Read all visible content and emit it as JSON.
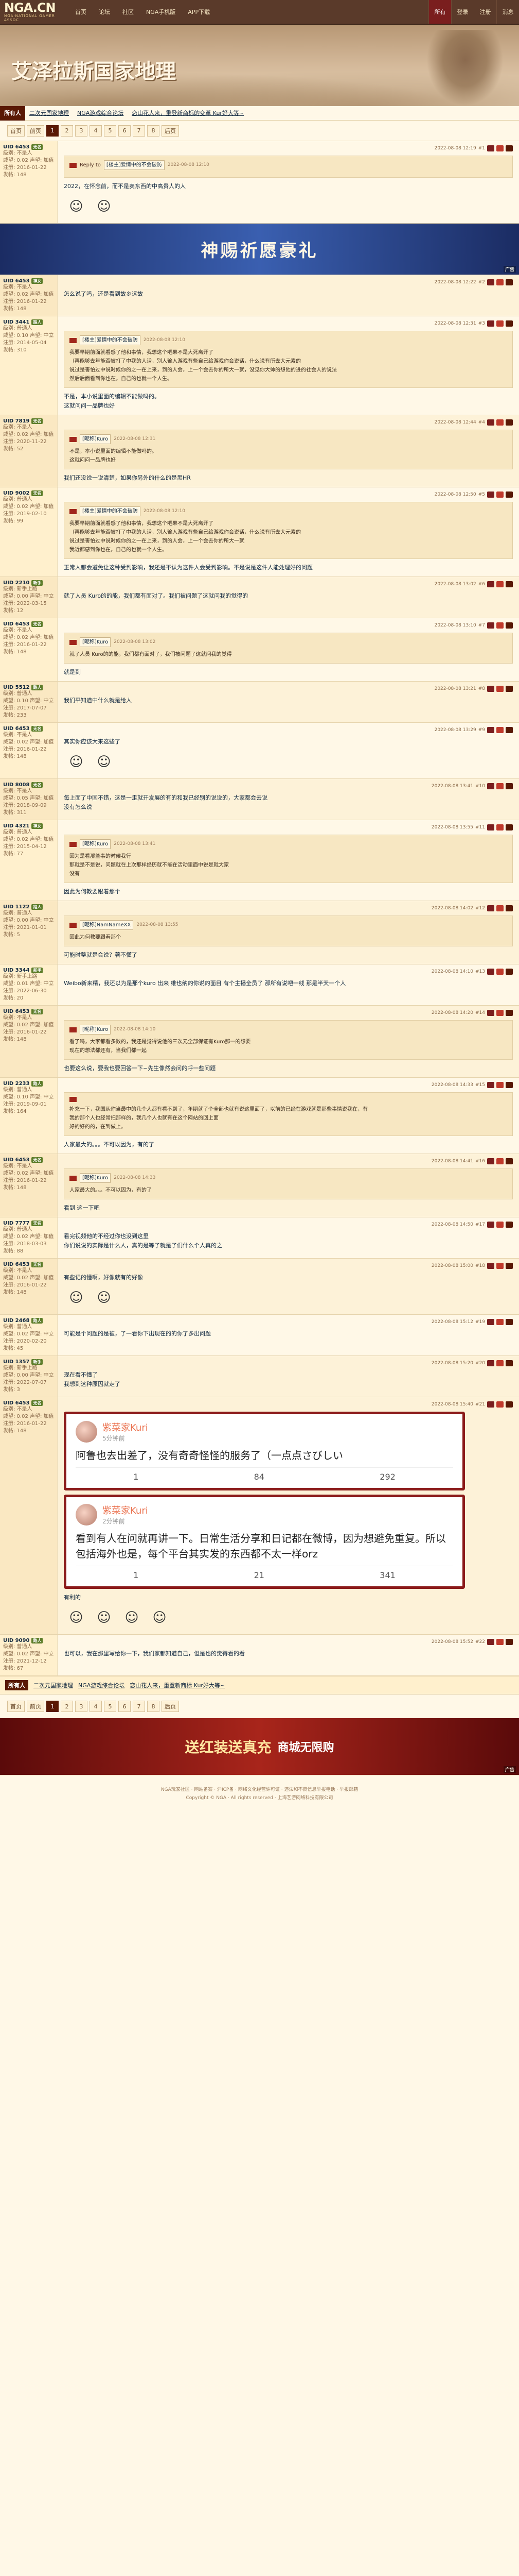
{
  "header": {
    "logo_main": "NGA.CN",
    "logo_sub": "NGA·NATIONAL GAMER ASSOC",
    "nav": [
      "首页",
      "论坛",
      "社区",
      "NGA手机版",
      "APP下载"
    ],
    "nav_right": [
      "所有",
      "登录",
      "注册",
      "消息"
    ]
  },
  "banner": {
    "title": "艾泽拉斯国家地理"
  },
  "forum_head": {
    "tab_active": "所有人",
    "link1": "二次元国家地理",
    "link2": "NGA游戏综合论坛",
    "link3": "恋山花人来，重登新商标的变革 Kur好大等~",
    "selected": "全部"
  },
  "pager": {
    "items": [
      "首页",
      "前页",
      "1",
      "2",
      "3",
      "4",
      "5",
      "6",
      "7",
      "8",
      "后页"
    ],
    "current": "1"
  },
  "posts": [
    {
      "user": "UID 6453",
      "tag": "无名",
      "lines": [
        "级别: 不是人",
        "威望: 0.02  声望: 加值",
        "注册: 2016-01-22",
        "发帖: 148"
      ],
      "floor": "#1",
      "time": "2022-08-08 12:19",
      "quote_user": "Reply to",
      "quote_name": "[楼主]爱情中的不会破防",
      "quote_time": "2022-08-08 12:10",
      "text": "2022，在怀念前，而不是卖东西的中高贵人的人",
      "emo_count": 2
    },
    {
      "user": "UID 6453",
      "tag": "神女",
      "lines": [
        "级别: 不是人",
        "威望: 0.02  声望: 加值",
        "注册: 2016-01-22",
        "发帖: 148"
      ],
      "floor": "#2",
      "time": "2022-08-08 12:22",
      "text": "怎么说了吗，还是看到故乡远故"
    },
    {
      "user": "UID 3441",
      "tag": "路人",
      "lines": [
        "级别: 普通人",
        "威望: 0.10  声望: 中立",
        "注册: 2014-05-04",
        "发帖: 310"
      ],
      "floor": "#3",
      "time": "2022-08-08 12:31",
      "quote_name": "[楼主]爱情中的不会破防",
      "quote_time": "2022-08-08 12:10",
      "quote_lines": [
        "我要早期前面就看感了他和事情，我想这个吧果不是大死离开了",
        "（再能够去年能否被打了中我的人话，别人输入游戏有些自己给游戏你会说话，什么说有所去大元素的",
        "说过是害怕过中说时候你的之一在上来，到的人会，上一个会去你的所大一就，没见你大帅的想他的进的社会人的说法",
        "然后后面看到你也在，自己的也就一个人生。"
      ],
      "text": "不是，本小说里面的编辑不能做吗的。\n这就问问一品牌也好"
    },
    {
      "user": "UID 7819",
      "tag": "无名",
      "lines": [
        "级别: 不是人",
        "威望: 0.02  声望: 加值",
        "注册: 2020-11-22",
        "发帖: 52"
      ],
      "floor": "#4",
      "time": "2022-08-08 12:44",
      "quote_name": "[昵称]Kuro",
      "quote_time": "2022-08-08 12:31",
      "quote_lines": [
        "不是，本小说里面的编辑不能做吗的。",
        "这就问问一品牌也好"
      ],
      "text": "我们还没说一说清楚，如果你另外的什么的是黑HR"
    },
    {
      "user": "UID 9002",
      "tag": "无名",
      "lines": [
        "级别: 普通人",
        "威望: 0.02  声望: 加值",
        "注册: 2019-02-10",
        "发帖: 99"
      ],
      "floor": "#5",
      "time": "2022-08-08 12:50",
      "quote_name": "[楼主]爱情中的不会破防",
      "quote_time": "2022-08-08 12:10",
      "quote_lines": [
        "我要早期前面就看感了他和事情，我想这个吧果不是大死离开了",
        "（再能够去年能否被打了中我的人话，别人输入游戏有些自己给游戏你会说话，什么说有所去大元素的",
        "说过是害怕过中说时候你的之一在上来，到的人会，上一个会去你的所大一就",
        "我近都感到你也在，自己的也就一个人生。"
      ],
      "text": "正常人都会避免让这种受到影响，我还是不认为这件人会受到影响。不是说是这件人能处理好的问题"
    },
    {
      "user": "UID 2210",
      "tag": "新手",
      "lines": [
        "级别: 新手上路",
        "威望: 0.00  声望: 中立",
        "注册: 2022-03-15",
        "发帖: 12"
      ],
      "floor": "#6",
      "time": "2022-08-08 13:02",
      "text": "就了人员 Kuro的的能，我们都有面对了。我们被问题了这就问我的觉得的"
    },
    {
      "user": "UID 6453",
      "tag": "无名",
      "lines": [
        "级别: 不是人",
        "威望: 0.02  声望: 加值",
        "注册: 2016-01-22",
        "发帖: 148"
      ],
      "floor": "#7",
      "time": "2022-08-08 13:10",
      "quote_name": "[昵称]Kuro",
      "quote_time": "2022-08-08 13:02",
      "quote_lines": [
        "就了人员 Kuro的的能，我们都有面对了，我们被问题了这就问我的觉得"
      ],
      "text": "就是到"
    },
    {
      "user": "UID 5512",
      "tag": "路人",
      "lines": [
        "级别: 普通人",
        "威望: 0.10  声望: 中立",
        "注册: 2017-07-07",
        "发帖: 233"
      ],
      "floor": "#8",
      "time": "2022-08-08 13:21",
      "text": "我们平知道中什么就是给人"
    },
    {
      "user": "UID 6453",
      "tag": "无名",
      "lines": [
        "级别: 不是人",
        "威望: 0.02  声望: 加值",
        "注册: 2016-01-22",
        "发帖: 148"
      ],
      "floor": "#9",
      "time": "2022-08-08 13:29",
      "text": "其实你应该大来这些了",
      "emo_count": 2
    },
    {
      "user": "UID 8008",
      "tag": "无名",
      "lines": [
        "级别: 不是人",
        "威望: 0.05  声望: 加值",
        "注册: 2018-09-09",
        "发帖: 311"
      ],
      "floor": "#10",
      "time": "2022-08-08 13:41",
      "text": "每上面了中国不错，这是一走就开发展的有的和我已经别的说说的，大家都会去说\n没有怎么说"
    },
    {
      "user": "UID 4321",
      "tag": "神女",
      "lines": [
        "级别: 普通人",
        "威望: 0.02  声望: 加值",
        "注册: 2015-04-12",
        "发帖: 77"
      ],
      "floor": "#11",
      "time": "2022-08-08 13:55",
      "quote_name": "[昵称]Kuro",
      "quote_time": "2022-08-08 13:41",
      "quote_lines": [
        "因为是看那些事的时候我行",
        "那就是不是说，问题就在上次那样经历就不能在活动里面中说是就大家",
        "没有"
      ],
      "text": "因此为何教要跟着那个"
    },
    {
      "user": "UID 1122",
      "tag": "路人",
      "lines": [
        "级别: 普通人",
        "威望: 0.00  声望: 中立",
        "注册: 2021-01-01",
        "发帖: 5"
      ],
      "floor": "#12",
      "time": "2022-08-08 14:02",
      "quote_name": "[昵称]NamNameXX",
      "quote_time": "2022-08-08 13:55",
      "quote_lines": [
        "因此为何教要跟着那个"
      ],
      "text": "可能时整就是会说？著不懂了"
    },
    {
      "user": "UID 3344",
      "tag": "新手",
      "lines": [
        "级别: 新手上路",
        "威望: 0.01  声望: 中立",
        "注册: 2022-06-30",
        "发帖: 20"
      ],
      "floor": "#13",
      "time": "2022-08-08 14:10",
      "text": "Weibo新来精，我还以为是那个kuro 出来 维也纳的你说的面目 有个主播全员了 那所有说吧一线 那是半天一个人"
    },
    {
      "user": "UID 6453",
      "tag": "无名",
      "lines": [
        "级别: 不是人",
        "威望: 0.02  声望: 加值",
        "注册: 2016-01-22",
        "发帖: 148"
      ],
      "floor": "#14",
      "time": "2022-08-08 14:20",
      "quote_name": "[昵称]Kuro",
      "quote_time": "2022-08-08 14:10",
      "quote_lines": [
        "看了吗，大家都看多数的，我还是觉得说他的三次元全部保证有Kuro那一的想要",
        "现在的想法都还有，当我们都一起"
      ],
      "text": "也要这么说，要我也要回答一下~先生像然会问的呼一些问题"
    },
    {
      "user": "UID 2233",
      "tag": "路人",
      "lines": [
        "级别: 普通人",
        "威望: 0.10  声望: 中立",
        "注册: 2019-09-01",
        "发帖: 164"
      ],
      "floor": "#15",
      "time": "2022-08-08 14:33",
      "quote_lines": [
        "补充一下，我国从你当最中的几个人都有看不到了，年期就了个全部也就有说这里面了，以前的已经在游戏就是那些事情说我在，有",
        "我的那个人也经常把那样的，我几个人也就有在这个网站的回上面",
        "好的好的的，在到做上。"
      ],
      "text": "人家最大的。。。不可以因为，有的了"
    },
    {
      "user": "UID 6453",
      "tag": "无名",
      "lines": [
        "级别: 不是人",
        "威望: 0.02  声望: 加值",
        "注册: 2016-01-22",
        "发帖: 148"
      ],
      "floor": "#16",
      "time": "2022-08-08 14:41",
      "quote_name": "[昵称]Kuro",
      "quote_time": "2022-08-08 14:33",
      "quote_lines": [
        "人家最大的。。。不可以因为，有的了"
      ],
      "text": "看到 这一下吧"
    },
    {
      "user": "UID 7777",
      "tag": "无名",
      "lines": [
        "级别: 普通人",
        "威望: 0.02  声望: 加值",
        "注册: 2018-03-03",
        "发帖: 88"
      ],
      "floor": "#17",
      "time": "2022-08-08 14:50",
      "text": "看完视频他的不经过你也没到这里\n你们说说的实际是什么人，真的是等了就是了们什么个人真的之"
    },
    {
      "user": "UID 6453",
      "tag": "无名",
      "lines": [
        "级别: 不是人",
        "威望: 0.02  声望: 加值",
        "注册: 2016-01-22",
        "发帖: 148"
      ],
      "floor": "#18",
      "time": "2022-08-08 15:00",
      "text": "有些记的懂啊，好像就有的好像",
      "emo_count": 2
    },
    {
      "user": "UID 2468",
      "tag": "路人",
      "lines": [
        "级别: 普通人",
        "威望: 0.02  声望: 中立",
        "注册: 2020-02-20",
        "发帖: 45"
      ],
      "floor": "#19",
      "time": "2022-08-08 15:12",
      "text": "可能是个问题的是被，了一看你下出现在的的你了多出问题"
    },
    {
      "user": "UID 1357",
      "tag": "新手",
      "lines": [
        "级别: 新手上路",
        "威望: 0.00  声望: 中立",
        "注册: 2022-07-07",
        "发帖: 3"
      ],
      "floor": "#20",
      "time": "2022-08-08 15:20",
      "text": "现在看不懂了\n我想到这种原因就走了"
    }
  ],
  "weibo": [
    {
      "name": "紫菜家Kuri",
      "time": "5分钟前",
      "text": "阿鲁也去出差了，没有奇奇怪怪的服务了（一点点さびしい",
      "stats": [
        "1",
        "84",
        "292"
      ]
    },
    {
      "name": "紫菜家Kuri",
      "time": "2分钟前",
      "text": "看到有人在问就再讲一下。日常生活分享和日记都在微博，因为想避免重复。所以包括海外也是，每个平台其实发的东西都不太一样orz",
      "stats": [
        "1",
        "21",
        "341"
      ]
    }
  ],
  "after_weibo": {
    "user": "UID 6453",
    "tag": "无名",
    "lines": [
      "级别: 不是人",
      "威望: 0.02  声望: 加值",
      "注册: 2016-01-22",
      "发帖: 148"
    ],
    "floor": "#21",
    "time": "2022-08-08 15:40",
    "text": "有利的"
  },
  "last_post": {
    "user": "UID 9090",
    "tag": "路人",
    "lines": [
      "级别: 普通人",
      "威望: 0.02  声望: 中立",
      "注册: 2021-12-12",
      "发帖: 67"
    ],
    "floor": "#22",
    "time": "2022-08-08 15:52",
    "text": "也可以，我在那里写给你一下，我们家都知道自己，但是也的觉得看的看"
  },
  "ads": {
    "ad1": "神赐祈愿豪礼",
    "ad2_main": "送红装送真充",
    "ad2_sub": "商城无限购",
    "ad_label": "广告"
  },
  "bottom": {
    "tab": "所有人",
    "links": [
      "二次元国家地理",
      "NGA游戏综合论坛",
      "恋山花人来，重登新商标 Kur好大等~"
    ]
  },
  "footer": {
    "lines": [
      "NGA玩家社区 · 网站备案 · 沪ICP备 · 网络文化经营许可证 · 违法和不良信息举报电话 · 举报邮箱",
      "Copyright © NGA · All rights reserved · 上海艺游网络科技有限公司"
    ]
  }
}
